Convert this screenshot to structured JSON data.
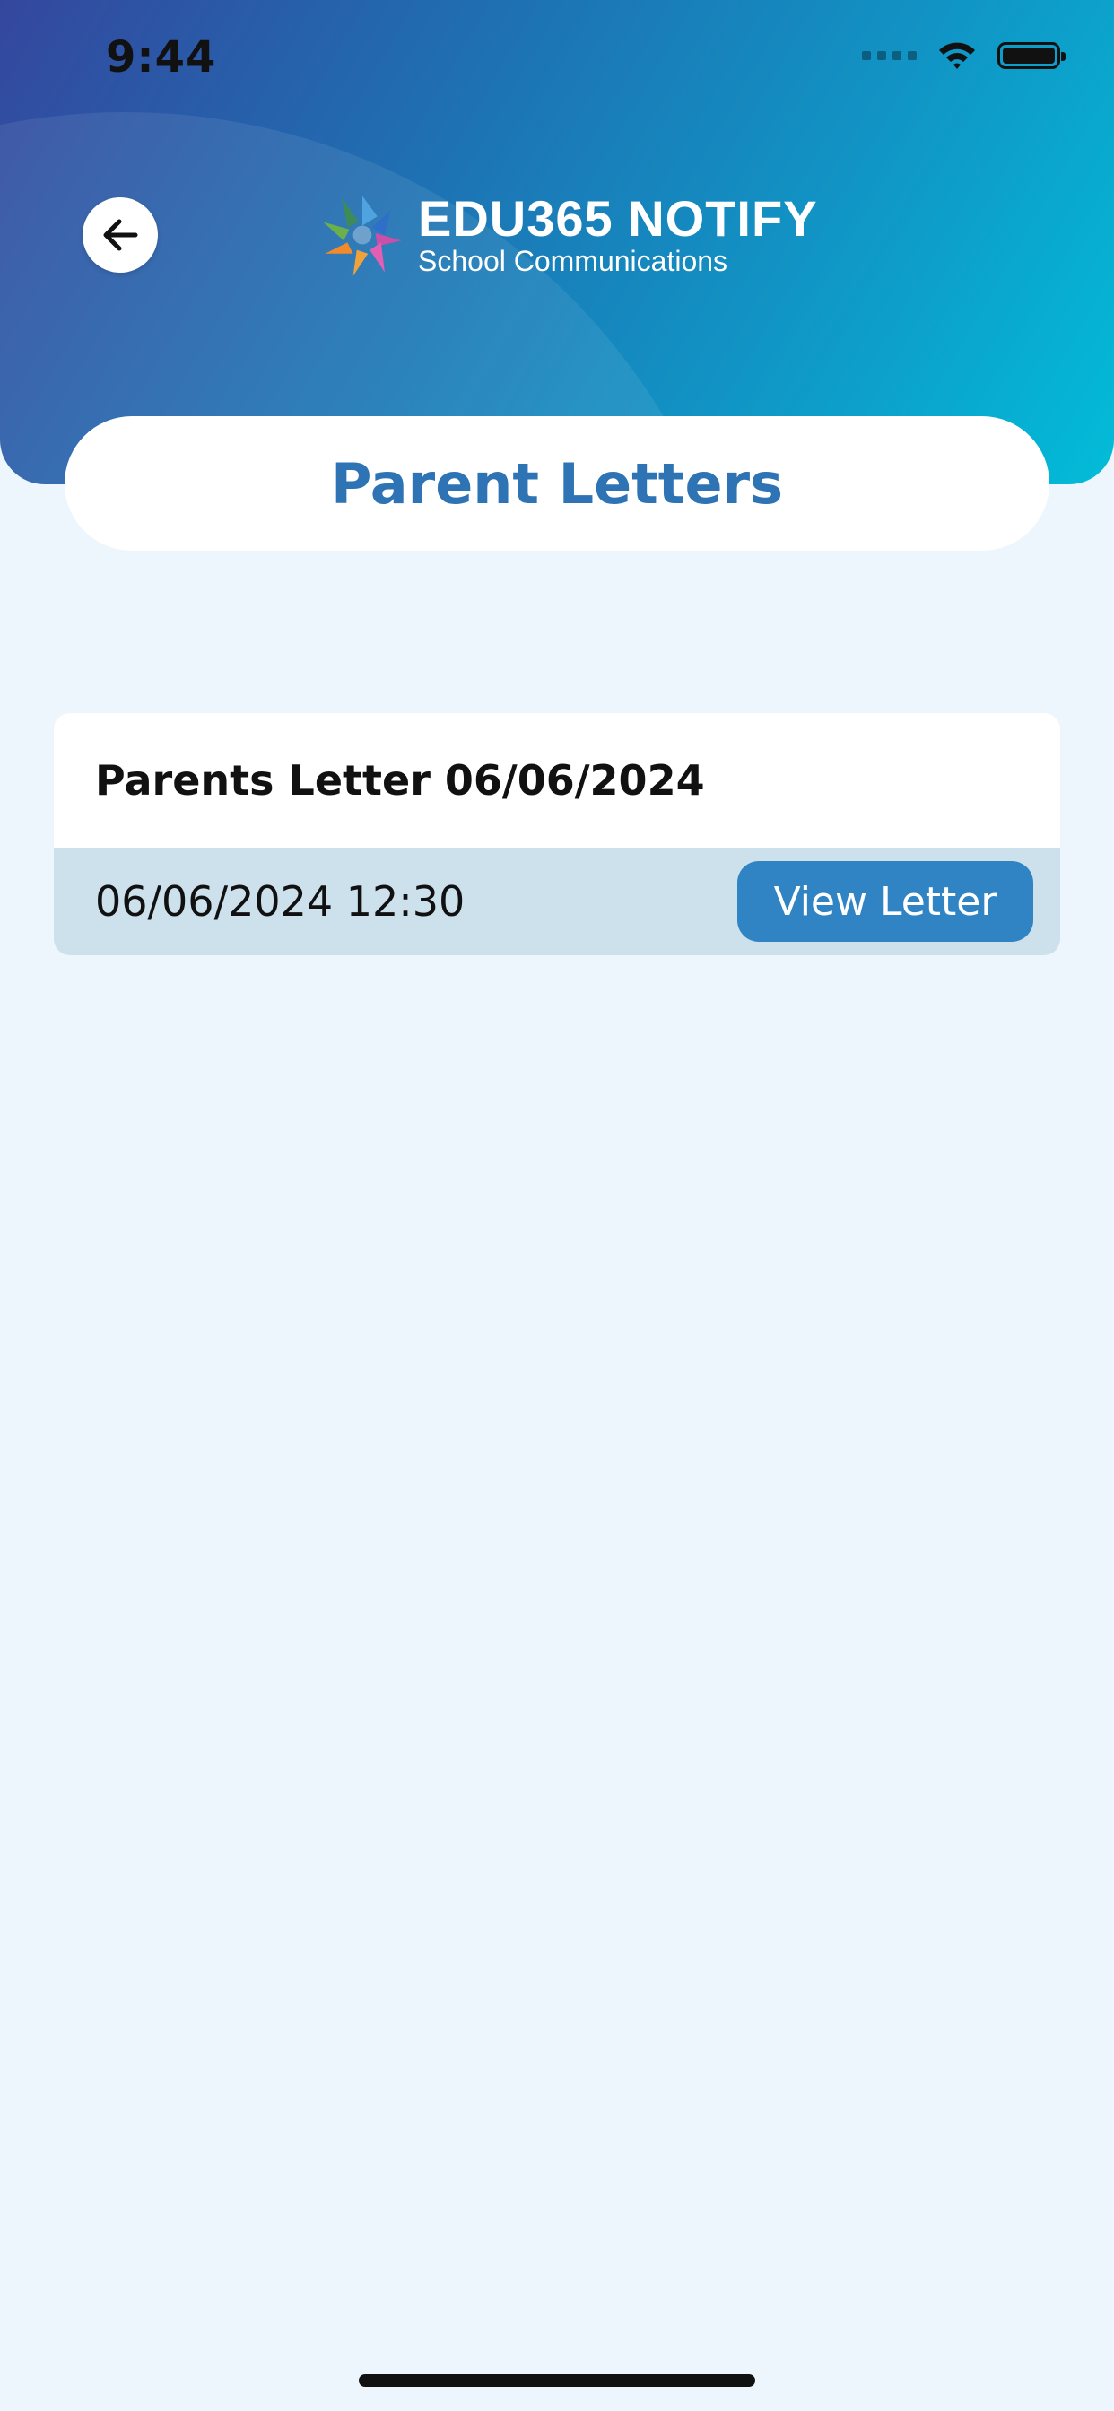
{
  "status_bar": {
    "time": "9:44",
    "icons": [
      "signal-dots-icon",
      "wifi-icon",
      "battery-icon"
    ]
  },
  "header": {
    "back_icon": "arrow-left-icon",
    "logo": {
      "title": "EDU365 NOTIFY",
      "subtitle": "School Communications"
    },
    "colors": {
      "gradient_start": "#34479e",
      "gradient_end": "#02bcd8"
    }
  },
  "page": {
    "title": "Parent Letters",
    "title_color": "#2e74b5",
    "background": "#ecf6fc"
  },
  "letters": [
    {
      "title": "Parents Letter 06/06/2024",
      "datetime": "06/06/2024 12:30",
      "button_label": "View Letter"
    }
  ],
  "accent_color": "#3084c3"
}
